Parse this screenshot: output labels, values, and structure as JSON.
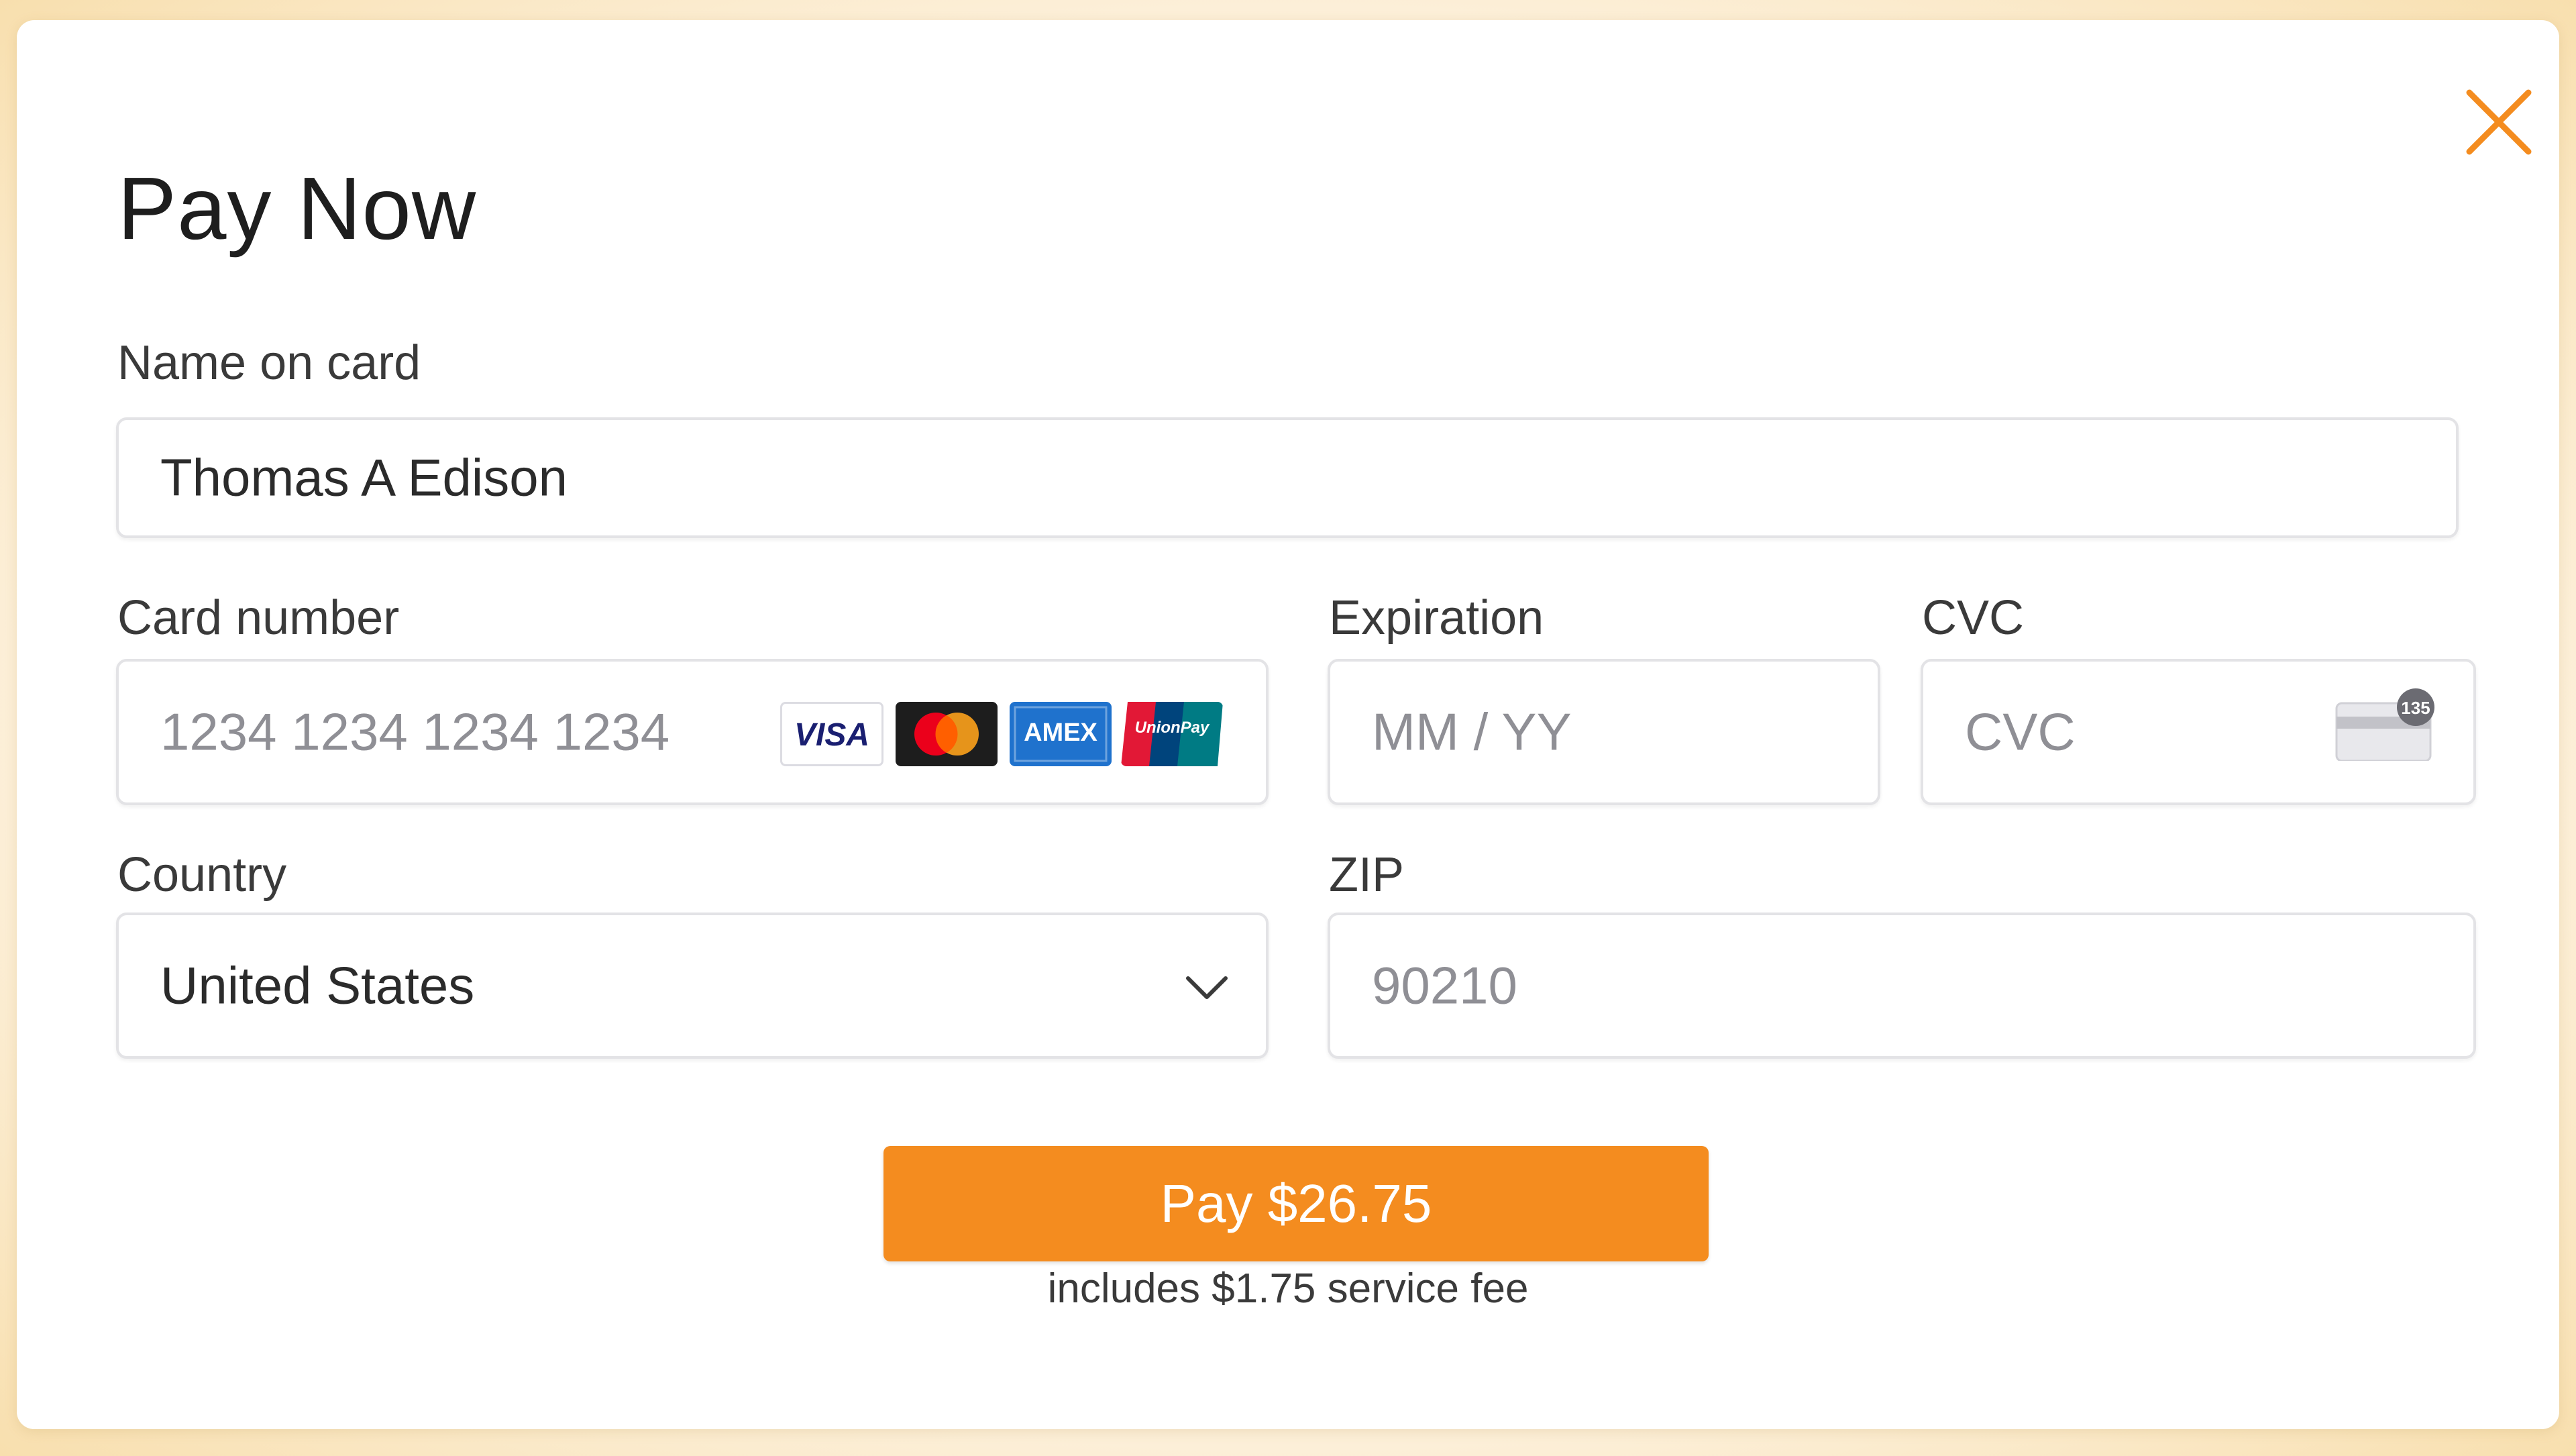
{
  "modal": {
    "title": "Pay Now",
    "close_icon": "close-icon",
    "accent_color": "#f48c1f"
  },
  "form": {
    "name": {
      "label": "Name on card",
      "value": "Thomas A Edison"
    },
    "card_number": {
      "label": "Card number",
      "placeholder": "1234 1234 1234 1234",
      "brands": [
        "VISA",
        "Mastercard",
        "AMEX",
        "UnionPay"
      ]
    },
    "expiration": {
      "label": "Expiration",
      "placeholder": "MM / YY"
    },
    "cvc": {
      "label": "CVC",
      "placeholder": "CVC",
      "icon_text": "135"
    },
    "country": {
      "label": "Country",
      "value": "United States"
    },
    "zip": {
      "label": "ZIP",
      "placeholder": "90210"
    }
  },
  "payment": {
    "button_label": "Pay $26.75",
    "fee_note": "includes $1.75 service fee"
  }
}
